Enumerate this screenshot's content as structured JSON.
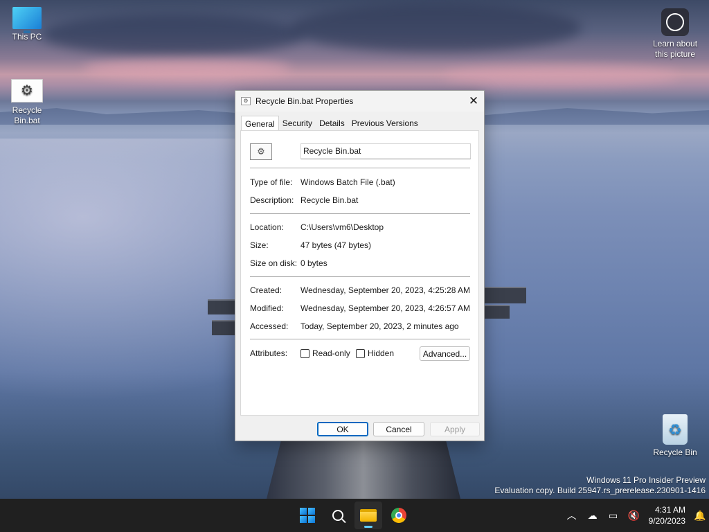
{
  "desktop": {
    "icons": [
      {
        "label": "This PC"
      },
      {
        "label": "Recycle Bin.bat"
      },
      {
        "label": "Learn about this picture"
      },
      {
        "label": "Recycle Bin"
      }
    ]
  },
  "dialog": {
    "title": "Recycle Bin.bat Properties",
    "tabs": [
      {
        "label": "General"
      },
      {
        "label": "Security"
      },
      {
        "label": "Details"
      },
      {
        "label": "Previous Versions"
      }
    ],
    "file_name": "Recycle Bin.bat",
    "fields": {
      "type_label": "Type of file:",
      "type_value": "Windows Batch File (.bat)",
      "desc_label": "Description:",
      "desc_value": "Recycle Bin.bat",
      "location_label": "Location:",
      "location_value": "C:\\Users\\vm6\\Desktop",
      "size_label": "Size:",
      "size_value": "47 bytes (47 bytes)",
      "disk_label": "Size on disk:",
      "disk_value": "0 bytes",
      "created_label": "Created:",
      "created_value": "Wednesday, September 20, 2023, 4:25:28 AM",
      "modified_label": "Modified:",
      "modified_value": "Wednesday, September 20, 2023, 4:26:57 AM",
      "accessed_label": "Accessed:",
      "accessed_value": "Today, September 20, 2023, 2 minutes ago",
      "attributes_label": "Attributes:"
    },
    "readonly_label": "Read-only",
    "hidden_label": "Hidden",
    "advanced_label": "Advanced...",
    "ok_label": "OK",
    "cancel_label": "Cancel",
    "apply_label": "Apply"
  },
  "watermark": {
    "line1": "Windows 11 Pro Insider Preview",
    "line2": "Evaluation copy. Build 25947.rs_prerelease.230901-1416"
  },
  "taskbar": {
    "time": "4:31 AM",
    "date": "9/20/2023",
    "accent": "#60cdff"
  }
}
